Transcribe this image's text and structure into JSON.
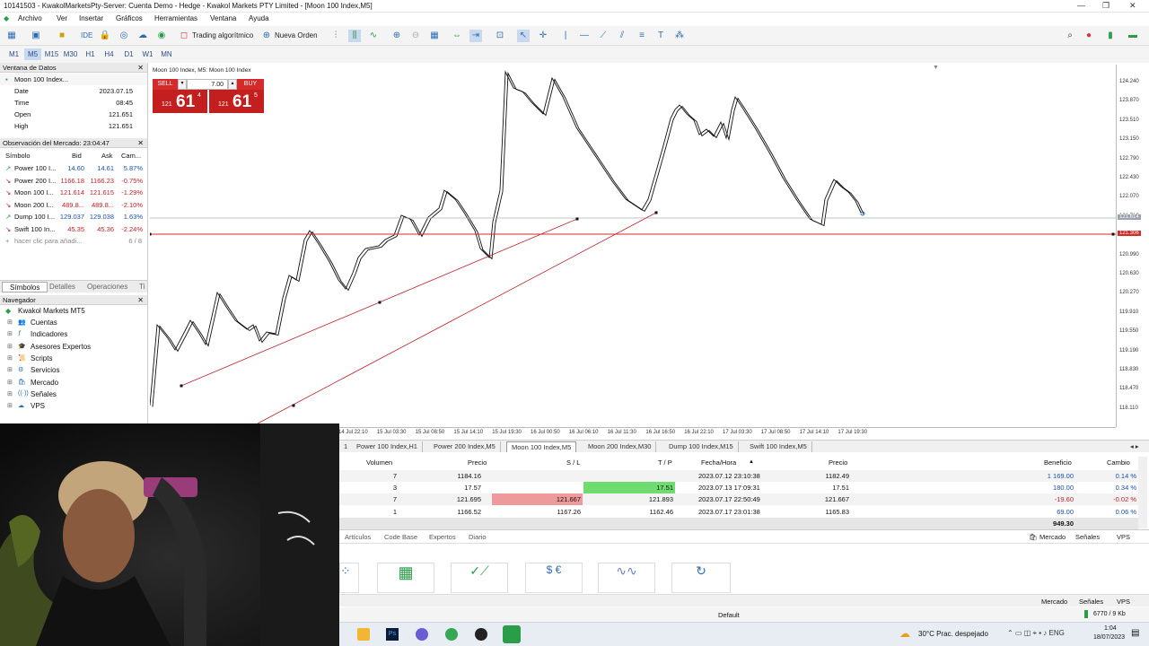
{
  "window": {
    "title": "10141503 - KwakolMarketsPty-Server: Cuenta Demo - Hedge - Kwakol Markets PTY Limited - [Moon 100 Index,M5]"
  },
  "menu": [
    "Archivo",
    "Ver",
    "Insertar",
    "Gráficos",
    "Herramientas",
    "Ventana",
    "Ayuda"
  ],
  "toolbar": {
    "algo_label": "Trading algorítmico",
    "new_order_label": "Nueva Orden",
    "ide_label": "IDE"
  },
  "timeframes": [
    "M1",
    "M5",
    "M15",
    "M30",
    "H1",
    "H4",
    "D1",
    "W1",
    "MN"
  ],
  "selected_timeframe": "M5",
  "data_window": {
    "title": "Ventana de Datos",
    "symbol": "Moon 100 Index...",
    "rows": [
      {
        "label": "Date",
        "value": "2023.07.15"
      },
      {
        "label": "Time",
        "value": "08:45"
      },
      {
        "label": "Open",
        "value": "121.651"
      },
      {
        "label": "High",
        "value": "121.651"
      }
    ]
  },
  "market_watch": {
    "title": "Observación del Mercado: 23:04:47",
    "headers": [
      "Símbolo",
      "Bid",
      "Ask",
      "Cam..."
    ],
    "rows": [
      {
        "symbol": "Power 100 I...",
        "bid": "14.60",
        "ask": "14.61",
        "change": "5.87%",
        "dir": "up"
      },
      {
        "symbol": "Power 200 I...",
        "bid": "1166.18",
        "ask": "1166.23",
        "change": "-0.75%",
        "dir": "down"
      },
      {
        "symbol": "Moon 100 I...",
        "bid": "121.614",
        "ask": "121.615",
        "change": "-1.29%",
        "dir": "down"
      },
      {
        "symbol": "Moon 200 I...",
        "bid": "489.8...",
        "ask": "489.8...",
        "change": "-2.10%",
        "dir": "down"
      },
      {
        "symbol": "Dump 100 I...",
        "bid": "129.037",
        "ask": "129.038",
        "change": "1.63%",
        "dir": "up"
      },
      {
        "symbol": "Swift 100 In...",
        "bid": "45.35",
        "ask": "45.36",
        "change": "-2.24%",
        "dir": "down"
      }
    ],
    "add_hint": "hacer clic para añadi...",
    "count": "6 / 8",
    "tabs": [
      "Símbolos",
      "Detalles",
      "Operaciones",
      "Ti"
    ]
  },
  "navigator": {
    "title": "Navegador",
    "root": "Kwakol Markets MT5",
    "items": [
      "Cuentas",
      "Indicadores",
      "Asesores Expertos",
      "Scripts",
      "Servicios",
      "Mercado",
      "Señales",
      "VPS"
    ]
  },
  "chart": {
    "header": "Moon 100 Index, M5: Moon 100 Index",
    "sell_label": "SELL",
    "buy_label": "BUY",
    "volume": "7.00",
    "sell_price_small": "121",
    "sell_price_big": "61",
    "sell_price_sup": "4",
    "buy_price_small": "121",
    "buy_price_big": "61",
    "buy_price_sup": "5",
    "price_axis": [
      "124.240",
      "123.870",
      "123.510",
      "123.150",
      "122.790",
      "122.430",
      "122.070",
      "121.710",
      "121.350",
      "120.990",
      "120.630",
      "120.270",
      "119.910",
      "119.550",
      "119.190",
      "118.830",
      "118.470",
      "118.110"
    ],
    "bid_tag": "121.614",
    "red_tag": "121.306",
    "time_axis": [
      "14 Jul 22:10",
      "15 Jul 03:30",
      "15 Jul 08:50",
      "15 Jul 14:10",
      "15 Jul 19:30",
      "16 Jul 00:50",
      "16 Jul 06:10",
      "16 Jul 11:30",
      "16 Jul 16:50",
      "16 Jul 22:10",
      "17 Jul 03:30",
      "17 Jul 08:50",
      "17 Jul 14:10",
      "17 Jul 19:30"
    ]
  },
  "chart_tabs": [
    "Power 100 Index,H1",
    "Power 200 Index,M5",
    "Moon 100 Index,M5",
    "Moon 200 Index,M30",
    "Dump 100 Index,M15",
    "Swift 100 Index,M5"
  ],
  "trade": {
    "headers": {
      "volume": "Volumen",
      "price": "Precio",
      "sl": "S / L",
      "tp": "T / P",
      "time": "Fecha/Hora",
      "cur": "Precio",
      "profit": "Beneficio",
      "change": "Cambio"
    },
    "rows": [
      {
        "volume": "7",
        "price": "1184.16",
        "sl": "",
        "tp": "",
        "time": "2023.07.12 23:10:38",
        "cur": "1182.49",
        "profit": "1 169.00",
        "change": "0.14 %"
      },
      {
        "volume": "3",
        "price": "17.57",
        "sl": "",
        "tp": "17.51",
        "time": "2023.07.13 17:09:31",
        "cur": "17.51",
        "profit": "180.00",
        "change": "0.34 %"
      },
      {
        "volume": "7",
        "price": "121.695",
        "sl": "121.667",
        "tp": "121.893",
        "time": "2023.07.17 22:50:49",
        "cur": "121.667",
        "profit": "-19.60",
        "change": "-0.02 %"
      },
      {
        "volume": "1",
        "price": "1166.52",
        "sl": "1167.26",
        "tp": "1162.46",
        "time": "2023.07.17 23:01:38",
        "cur": "1165.83",
        "profit": "69.00",
        "change": "0.06 %"
      }
    ],
    "total": "949.30"
  },
  "toolbox_tabs": [
    "Artículos",
    "Code Base",
    "Expertos",
    "Diario"
  ],
  "toolbox_right": [
    "Mercado",
    "Señales",
    "VPS"
  ],
  "status": {
    "profile": "Default",
    "traffic": "6770 / 9 Kb"
  },
  "taskbar": {
    "weather": "30°C  Prac. despejado",
    "time": "1:04",
    "date": "18/07/2023"
  }
}
